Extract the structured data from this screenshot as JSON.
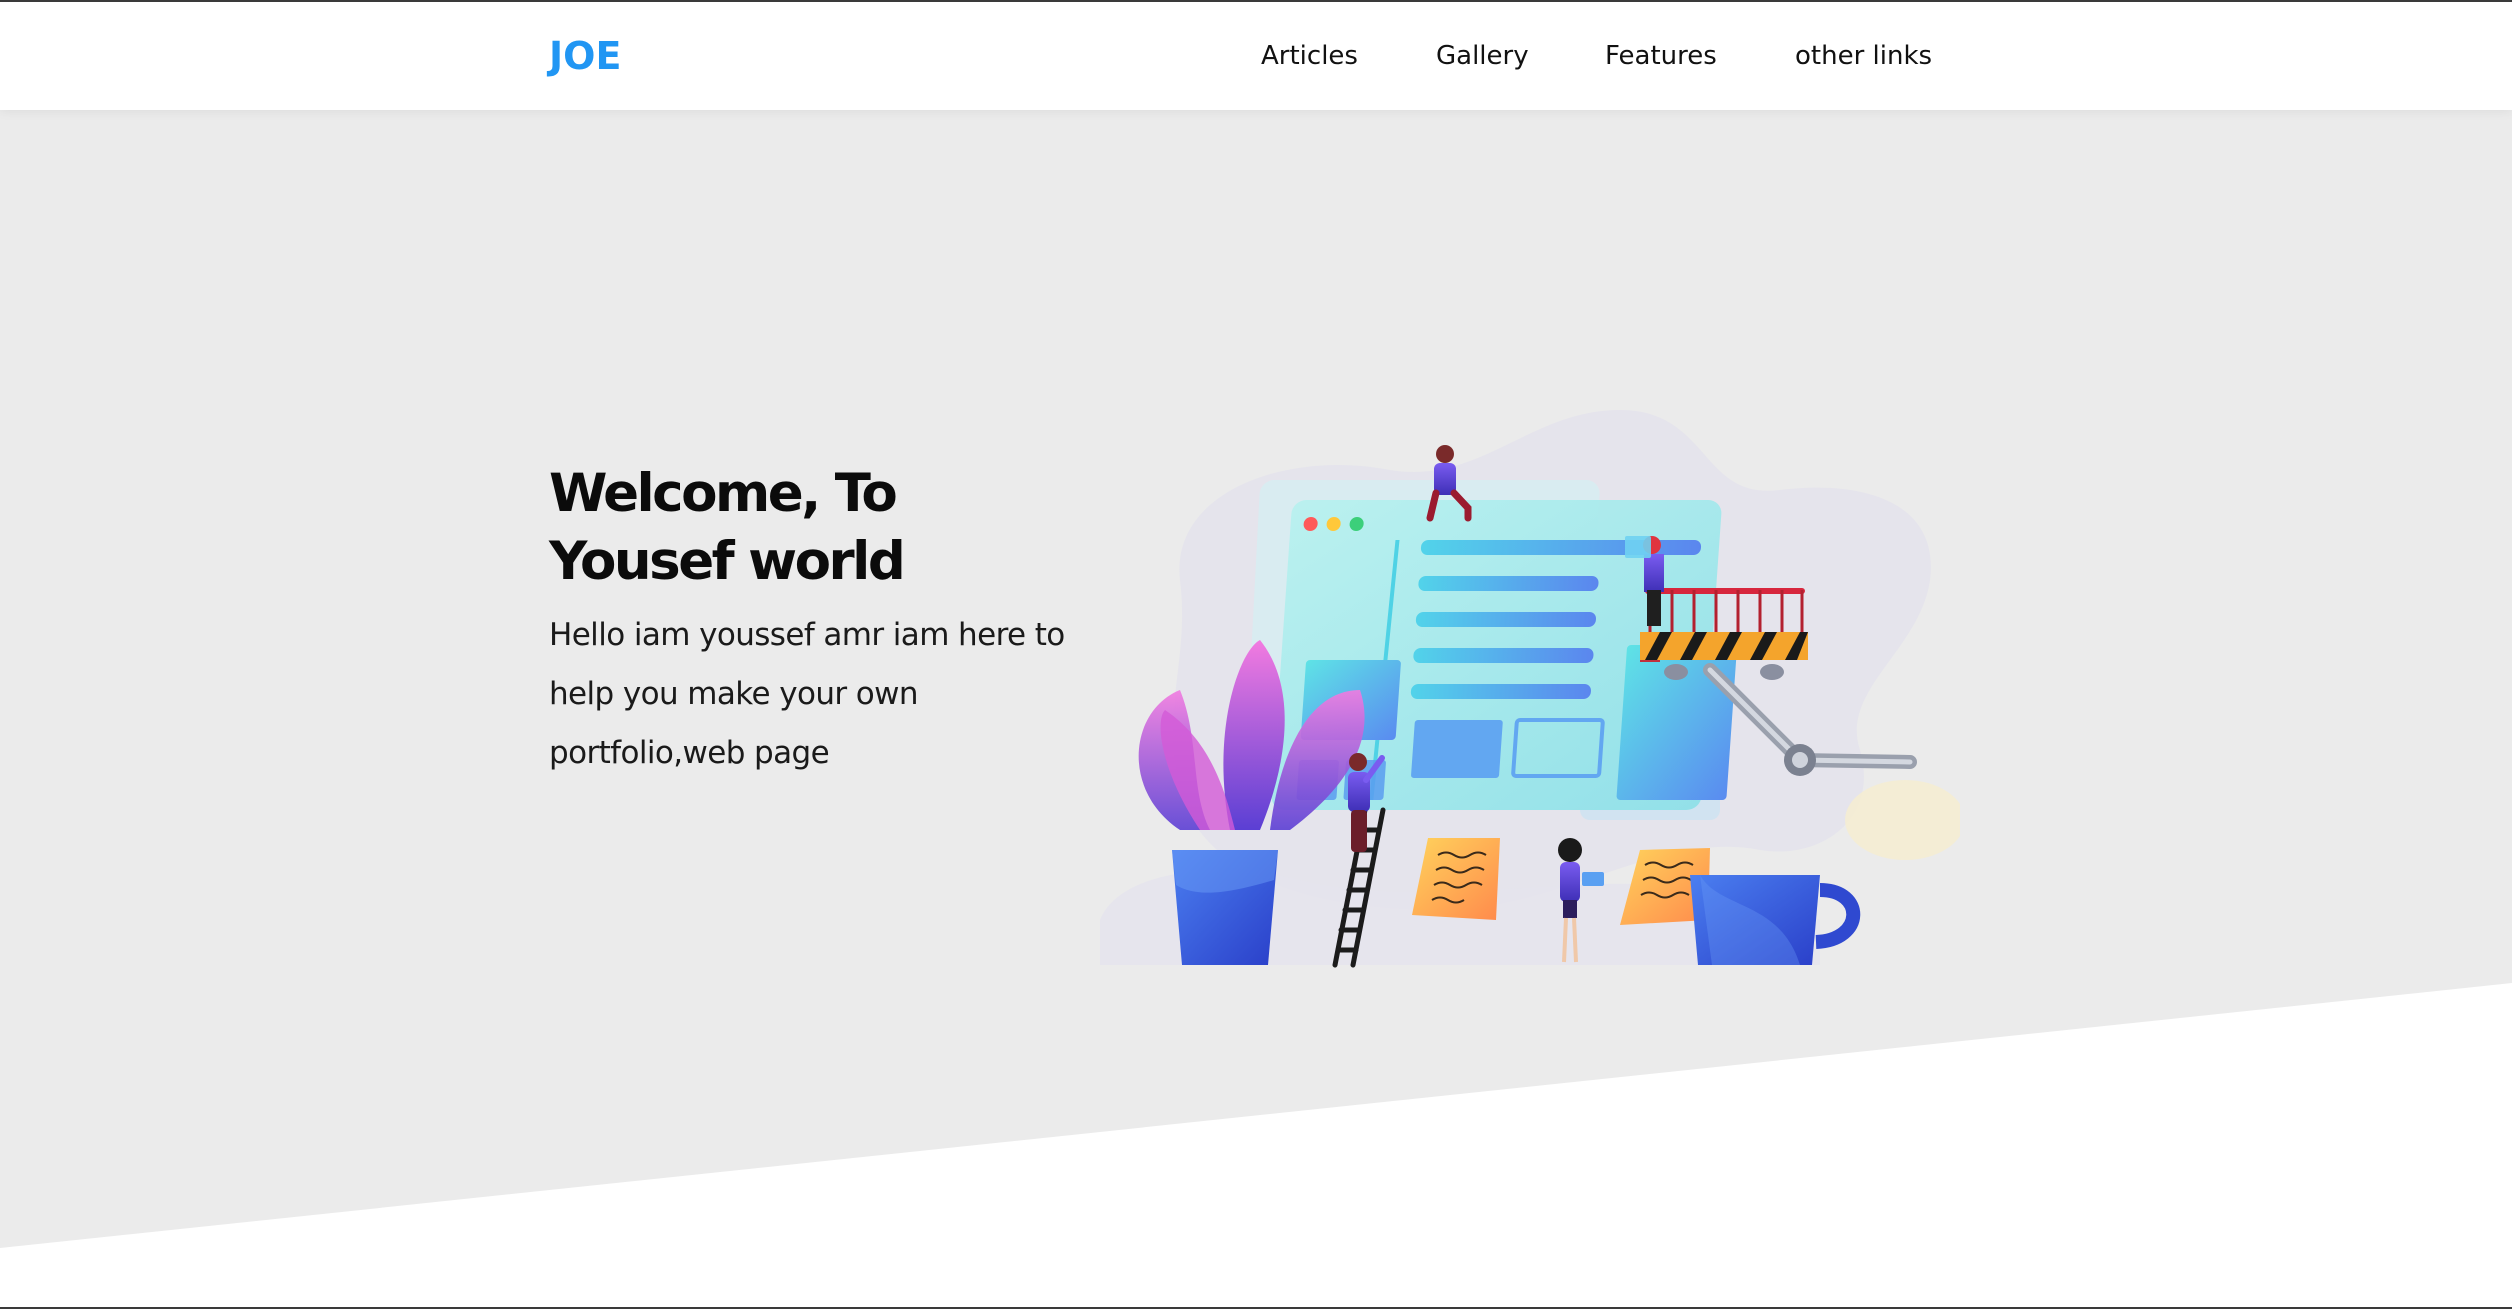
{
  "header": {
    "logo": "JOE",
    "nav": [
      {
        "label": "Articles"
      },
      {
        "label": "Gallery"
      },
      {
        "label": "Features"
      },
      {
        "label": "other links"
      }
    ]
  },
  "hero": {
    "title": "Welcome, To Yousef world",
    "text": "Hello iam youssef amr iam here to help you make your own portfolio,web page",
    "illustration": "web-development-team-illustration"
  },
  "scroll": {
    "icon": "double-chevron-down-icon"
  },
  "colors": {
    "accent": "#2196f3",
    "hero_background": "#ebebeb",
    "header_background": "#ffffff"
  }
}
